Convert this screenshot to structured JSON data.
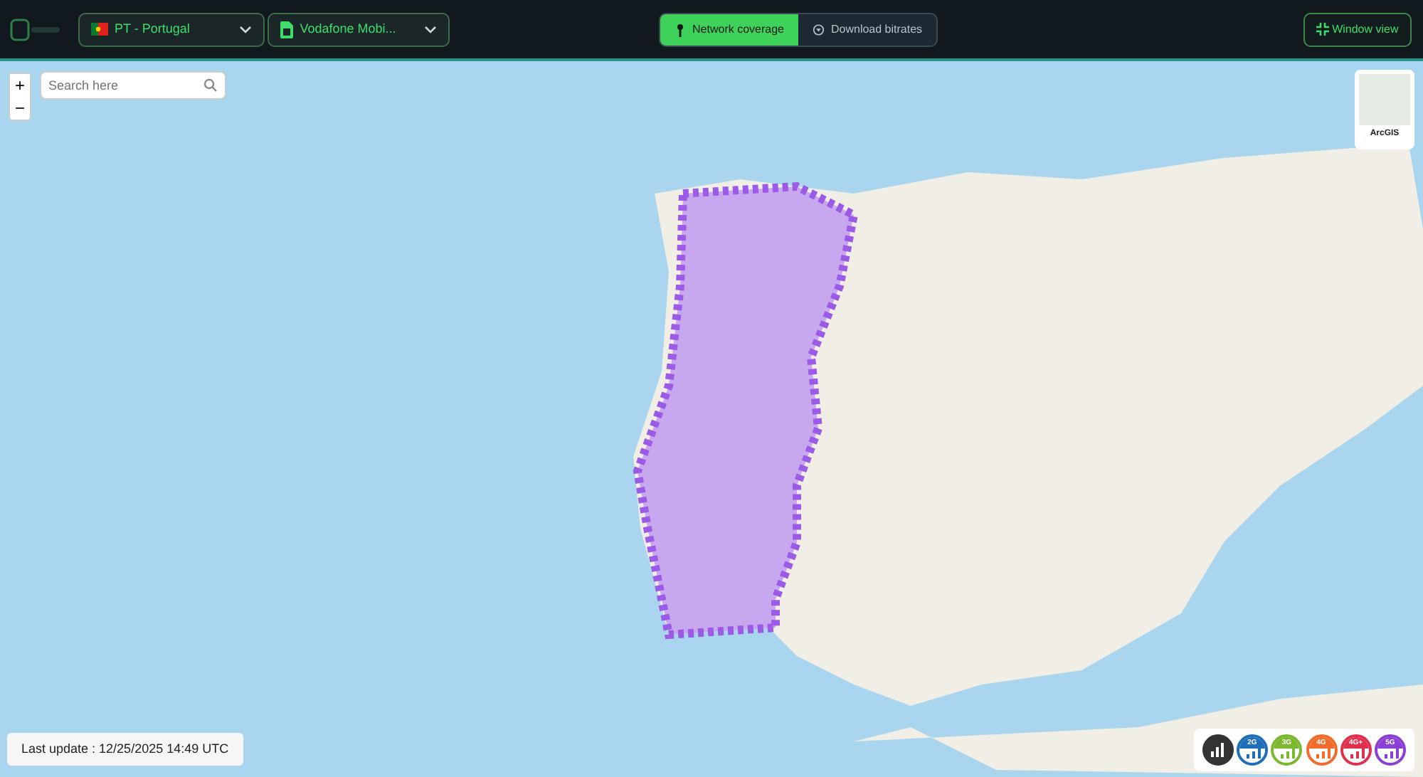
{
  "header": {
    "country": {
      "label": "PT - Portugal"
    },
    "operator": {
      "label": "Vodafone Mobi..."
    },
    "tabs": [
      {
        "label": "Network coverage",
        "selected": true,
        "kind": "antenna"
      },
      {
        "label": "Download bitrates",
        "selected": false,
        "kind": "download"
      }
    ],
    "window_button": {
      "label": "Window view"
    }
  },
  "map": {
    "zoom_in": "+",
    "zoom_out": "−",
    "search": {
      "placeholder": "Search here"
    },
    "basemap": {
      "label": "ArcGIS"
    },
    "last_update": "Last update : 12/25/2025 14:49 UTC",
    "legend": [
      {
        "kind": "all",
        "color": "#333333"
      },
      {
        "kind": "tech",
        "label": "2G",
        "color": "#1f6fb8"
      },
      {
        "kind": "tech",
        "label": "3G",
        "color": "#7cb82f"
      },
      {
        "kind": "tech",
        "label": "4G",
        "color": "#f26b2a"
      },
      {
        "kind": "tech",
        "label": "4G+",
        "color": "#e0304e"
      },
      {
        "kind": "tech",
        "label": "5G",
        "color": "#8a3fd6"
      }
    ]
  }
}
